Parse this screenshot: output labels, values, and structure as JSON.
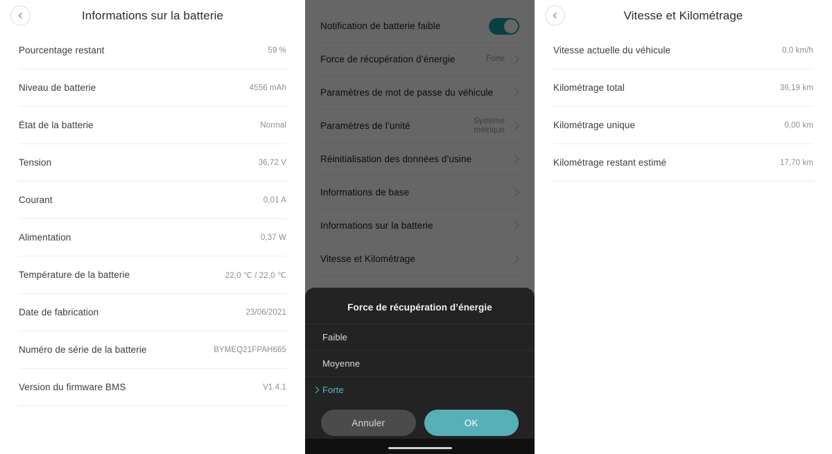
{
  "left_panel": {
    "back_icon": "chevron-left-icon",
    "title": "Informations sur la batterie",
    "rows": [
      {
        "label": "Pourcentage restant",
        "value": "59 %"
      },
      {
        "label": "Niveau de batterie",
        "value": "4556 mAh"
      },
      {
        "label": "État de la batterie",
        "value": "Normal"
      },
      {
        "label": "Tension",
        "value": "36,72 V"
      },
      {
        "label": "Courant",
        "value": "0,01 A"
      },
      {
        "label": "Alimentation",
        "value": "0,37 W"
      },
      {
        "label": "Température de la batterie",
        "value": "22,0 ℃ / 22,0 ℃"
      },
      {
        "label": "Date de fabrication",
        "value": "23/06/2021"
      },
      {
        "label": "Numéro de série de la batterie",
        "value": "BYMEQ21FPAH665"
      },
      {
        "label": "Version du firmware BMS",
        "value": "V1.4.1"
      }
    ]
  },
  "middle_panel": {
    "rows": [
      {
        "label": "Notification de batterie faible",
        "value": "",
        "control": "toggle",
        "toggle_on": true
      },
      {
        "label": "Force de récupération d’énergie",
        "value": "Forte",
        "control": "chevron"
      },
      {
        "label": "Paramètres de mot de passe du véhicule",
        "value": "",
        "control": "chevron"
      },
      {
        "label": "Paramètres de l’unité",
        "value": "Système métrique",
        "control": "chevron"
      },
      {
        "label": "Réinitialisation des données d’usine",
        "value": "",
        "control": "chevron"
      },
      {
        "label": "Informations de base",
        "value": "",
        "control": "chevron"
      },
      {
        "label": "Informations sur la batterie",
        "value": "",
        "control": "chevron"
      },
      {
        "label": "Vitesse et Kilométrage",
        "value": "",
        "control": "chevron"
      }
    ],
    "dialog": {
      "title": "Force de récupération d’énergie",
      "options": [
        {
          "label": "Faible",
          "selected": false
        },
        {
          "label": "Moyenne",
          "selected": false
        },
        {
          "label": "Forte",
          "selected": true
        }
      ],
      "cancel_label": "Annuler",
      "ok_label": "OK"
    }
  },
  "right_panel": {
    "back_icon": "chevron-left-icon",
    "title": "Vitesse et Kilométrage",
    "rows": [
      {
        "label": "Vitesse actuelle du véhicule",
        "value": "0,0 km/h"
      },
      {
        "label": "Kilométrage total",
        "value": "36,19 km"
      },
      {
        "label": "Kilométrage unique",
        "value": "0,00 km"
      },
      {
        "label": "Kilométrage restant estimé",
        "value": "17,70 km"
      }
    ]
  },
  "colors": {
    "accent_teal": "#56b0b8",
    "toggle_on": "#18a19e",
    "dialog_bg": "#232323",
    "selected_option": "#5bb8bf"
  }
}
